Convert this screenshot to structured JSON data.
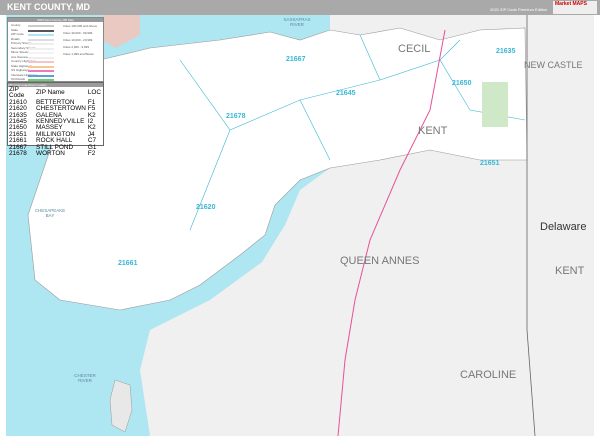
{
  "header": {
    "title": "KENT COUNTY, MD",
    "edition": "2020 ZIP Code Premium Edition",
    "logo": "Market MAPS"
  },
  "legend": {
    "title": "2020 Kent County, MD Map",
    "rows": [
      "County",
      "State",
      "ZIP Code",
      "Roads",
      "Primary Streets",
      "Secondary Streets",
      "Minor Streets",
      "Ave./Avenue",
      "Country Highways",
      "State Highways",
      "US Highways",
      "Interstate Highways",
      "Toll Roads"
    ],
    "city_sizes": [
      "Cities 100,000 and Above",
      "Cities 30,000 - 99,999",
      "Cities 10,000 - 29,999",
      "Cities 2,000 - 9,999",
      "Cities 1,999 and Below"
    ]
  },
  "zip_index": {
    "title": "ZIP Code Index/Kent Locator",
    "headers": [
      "ZIP Code",
      "ZIP Name",
      "LOC"
    ],
    "rows": [
      [
        "21610",
        "BETTERTON",
        "F1"
      ],
      [
        "21620",
        "CHESTERTOWN",
        "F5"
      ],
      [
        "21635",
        "GALENA",
        "K2"
      ],
      [
        "21645",
        "KENNEDYVILLE",
        "I2"
      ],
      [
        "21650",
        "MASSEY",
        "K2"
      ],
      [
        "21651",
        "MILLINGTON",
        "J4"
      ],
      [
        "21661",
        "ROCK HALL",
        "C7"
      ],
      [
        "21667",
        "STILL POND",
        "G1"
      ],
      [
        "21678",
        "WORTON",
        "F2"
      ]
    ]
  },
  "map": {
    "regions": [
      "CECIL",
      "NEW CASTLE",
      "KENT",
      "Delaware",
      "KENT",
      "QUEEN ANNES",
      "CAROLINE"
    ],
    "water": [
      "CHESAPEAKE BAY",
      "CHESTER RIVER",
      "SASSAFRAS RIVER"
    ],
    "zips": [
      "21667",
      "21635",
      "21650",
      "21645",
      "21678",
      "21651",
      "21620",
      "21661"
    ]
  },
  "colors": {
    "water": "#aee6f2",
    "land": "#f0f0f0",
    "county": "#ffffff",
    "zip_line": "#39b7d6",
    "highway": "#e8509a"
  }
}
